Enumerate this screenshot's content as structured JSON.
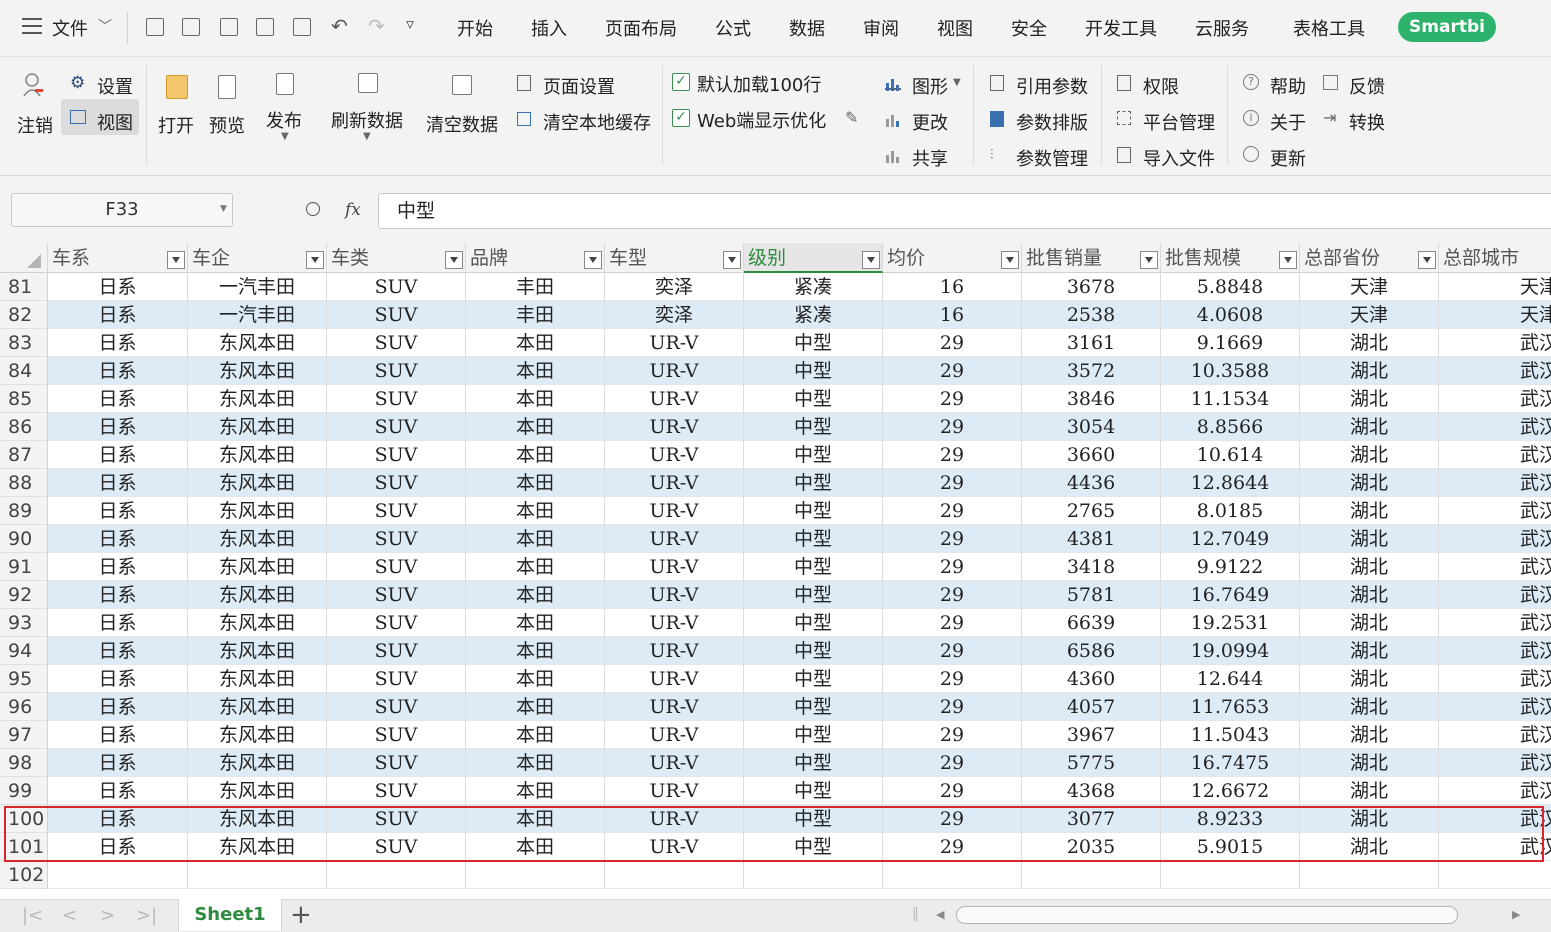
{
  "menubar": {
    "file": "文件",
    "tabs": [
      "开始",
      "插入",
      "页面布局",
      "公式",
      "数据",
      "审阅",
      "视图",
      "安全",
      "开发工具",
      "云服务",
      "表格工具"
    ],
    "smartbi": "Smartbi"
  },
  "ribbon": {
    "logout": "注销",
    "settings": "设置",
    "view": "视图",
    "open": "打开",
    "preview": "预览",
    "publish": "发布",
    "refresh": "刷新数据",
    "clear_data": "清空数据",
    "page_setup": "页面设置",
    "clear_cache": "清空本地缓存",
    "default_load": "默认加载100行",
    "web_opt": "Web端显示优化",
    "chart": "图形",
    "modify": "更改",
    "share": "共享",
    "ref_param": "引用参数",
    "param_layout": "参数排版",
    "param_manage": "参数管理",
    "permission": "权限",
    "platform": "平台管理",
    "import_file": "导入文件",
    "help": "帮助",
    "about": "关于",
    "update": "更新",
    "feedback": "反馈",
    "convert": "转换"
  },
  "formula": {
    "cell_ref": "F33",
    "fx": "fx",
    "value": "中型"
  },
  "columns": [
    "车系",
    "车企",
    "车类",
    "品牌",
    "车型",
    "级别",
    "均价",
    "批售销量",
    "批售规模",
    "总部省份",
    "总部城市"
  ],
  "rows": [
    {
      "n": "81",
      "v": [
        "日系",
        "一汽丰田",
        "SUV",
        "丰田",
        "奕泽",
        "紧凑",
        "16",
        "3678",
        "5.8848",
        "天津",
        "天津"
      ]
    },
    {
      "n": "82",
      "v": [
        "日系",
        "一汽丰田",
        "SUV",
        "丰田",
        "奕泽",
        "紧凑",
        "16",
        "2538",
        "4.0608",
        "天津",
        "天津"
      ]
    },
    {
      "n": "83",
      "v": [
        "日系",
        "东风本田",
        "SUV",
        "本田",
        "UR-V",
        "中型",
        "29",
        "3161",
        "9.1669",
        "湖北",
        "武汉"
      ]
    },
    {
      "n": "84",
      "v": [
        "日系",
        "东风本田",
        "SUV",
        "本田",
        "UR-V",
        "中型",
        "29",
        "3572",
        "10.3588",
        "湖北",
        "武汉"
      ]
    },
    {
      "n": "85",
      "v": [
        "日系",
        "东风本田",
        "SUV",
        "本田",
        "UR-V",
        "中型",
        "29",
        "3846",
        "11.1534",
        "湖北",
        "武汉"
      ]
    },
    {
      "n": "86",
      "v": [
        "日系",
        "东风本田",
        "SUV",
        "本田",
        "UR-V",
        "中型",
        "29",
        "3054",
        "8.8566",
        "湖北",
        "武汉"
      ]
    },
    {
      "n": "87",
      "v": [
        "日系",
        "东风本田",
        "SUV",
        "本田",
        "UR-V",
        "中型",
        "29",
        "3660",
        "10.614",
        "湖北",
        "武汉"
      ]
    },
    {
      "n": "88",
      "v": [
        "日系",
        "东风本田",
        "SUV",
        "本田",
        "UR-V",
        "中型",
        "29",
        "4436",
        "12.8644",
        "湖北",
        "武汉"
      ]
    },
    {
      "n": "89",
      "v": [
        "日系",
        "东风本田",
        "SUV",
        "本田",
        "UR-V",
        "中型",
        "29",
        "2765",
        "8.0185",
        "湖北",
        "武汉"
      ]
    },
    {
      "n": "90",
      "v": [
        "日系",
        "东风本田",
        "SUV",
        "本田",
        "UR-V",
        "中型",
        "29",
        "4381",
        "12.7049",
        "湖北",
        "武汉"
      ]
    },
    {
      "n": "91",
      "v": [
        "日系",
        "东风本田",
        "SUV",
        "本田",
        "UR-V",
        "中型",
        "29",
        "3418",
        "9.9122",
        "湖北",
        "武汉"
      ]
    },
    {
      "n": "92",
      "v": [
        "日系",
        "东风本田",
        "SUV",
        "本田",
        "UR-V",
        "中型",
        "29",
        "5781",
        "16.7649",
        "湖北",
        "武汉"
      ]
    },
    {
      "n": "93",
      "v": [
        "日系",
        "东风本田",
        "SUV",
        "本田",
        "UR-V",
        "中型",
        "29",
        "6639",
        "19.2531",
        "湖北",
        "武汉"
      ]
    },
    {
      "n": "94",
      "v": [
        "日系",
        "东风本田",
        "SUV",
        "本田",
        "UR-V",
        "中型",
        "29",
        "6586",
        "19.0994",
        "湖北",
        "武汉"
      ]
    },
    {
      "n": "95",
      "v": [
        "日系",
        "东风本田",
        "SUV",
        "本田",
        "UR-V",
        "中型",
        "29",
        "4360",
        "12.644",
        "湖北",
        "武汉"
      ]
    },
    {
      "n": "96",
      "v": [
        "日系",
        "东风本田",
        "SUV",
        "本田",
        "UR-V",
        "中型",
        "29",
        "4057",
        "11.7653",
        "湖北",
        "武汉"
      ]
    },
    {
      "n": "97",
      "v": [
        "日系",
        "东风本田",
        "SUV",
        "本田",
        "UR-V",
        "中型",
        "29",
        "3967",
        "11.5043",
        "湖北",
        "武汉"
      ]
    },
    {
      "n": "98",
      "v": [
        "日系",
        "东风本田",
        "SUV",
        "本田",
        "UR-V",
        "中型",
        "29",
        "5775",
        "16.7475",
        "湖北",
        "武汉"
      ]
    },
    {
      "n": "99",
      "v": [
        "日系",
        "东风本田",
        "SUV",
        "本田",
        "UR-V",
        "中型",
        "29",
        "4368",
        "12.6672",
        "湖北",
        "武汉"
      ]
    },
    {
      "n": "100",
      "v": [
        "日系",
        "东风本田",
        "SUV",
        "本田",
        "UR-V",
        "中型",
        "29",
        "3077",
        "8.9233",
        "湖北",
        "武汉"
      ]
    },
    {
      "n": "101",
      "v": [
        "日系",
        "东风本田",
        "SUV",
        "本田",
        "UR-V",
        "中型",
        "29",
        "2035",
        "5.9015",
        "湖北",
        "武汉"
      ]
    },
    {
      "n": "102",
      "v": [
        "",
        "",
        "",
        "",
        "",
        "",
        "",
        "",
        "",
        "",
        ""
      ]
    }
  ],
  "sheet": {
    "name": "Sheet1"
  },
  "colors": {
    "accent": "#2e8b3d",
    "alt_row": "#ddebf7",
    "highlight_border": "#d9262c",
    "smartbi": "#2db36b"
  }
}
